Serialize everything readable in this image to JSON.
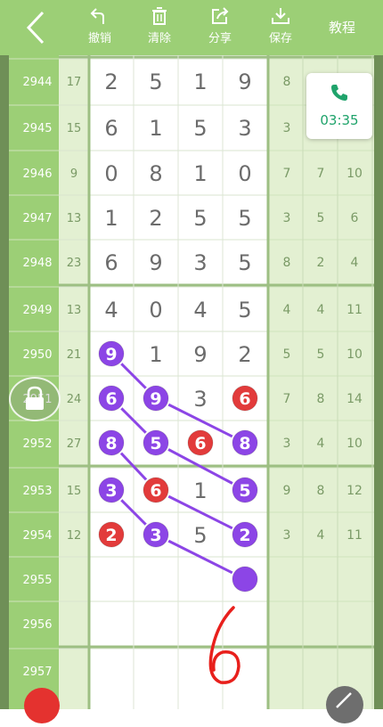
{
  "toolbar": {
    "undo_label": "撤销",
    "clear_label": "清除",
    "share_label": "分享",
    "save_label": "保存",
    "help_label": "教程",
    "icons": [
      "back-chevron-icon",
      "undo-icon",
      "trash-icon",
      "share-icon",
      "download-icon"
    ]
  },
  "call": {
    "time": "03:35"
  },
  "rows": [
    {
      "id": "2944",
      "sum": "17",
      "digits": [
        "2",
        "5",
        "1",
        "9"
      ],
      "stats": [
        "8",
        "",
        ""
      ]
    },
    {
      "id": "2945",
      "sum": "15",
      "digits": [
        "6",
        "1",
        "5",
        "3"
      ],
      "stats": [
        "3",
        "",
        ""
      ]
    },
    {
      "id": "2946",
      "sum": "9",
      "digits": [
        "0",
        "8",
        "1",
        "0"
      ],
      "stats": [
        "7",
        "7",
        "10"
      ]
    },
    {
      "id": "2947",
      "sum": "13",
      "digits": [
        "1",
        "2",
        "5",
        "5"
      ],
      "stats": [
        "3",
        "5",
        "6"
      ]
    },
    {
      "id": "2948",
      "sum": "23",
      "digits": [
        "6",
        "9",
        "3",
        "5"
      ],
      "stats": [
        "8",
        "2",
        "4"
      ]
    },
    {
      "id": "2949",
      "sum": "13",
      "digits": [
        "4",
        "0",
        "4",
        "5"
      ],
      "stats": [
        "4",
        "4",
        "11"
      ]
    },
    {
      "id": "2950",
      "sum": "21",
      "digits": [
        "9",
        "1",
        "9",
        "2"
      ],
      "stats": [
        "5",
        "5",
        "10"
      ]
    },
    {
      "id": "2951",
      "sum": "24",
      "digits": [
        "6",
        "9",
        "3",
        "6"
      ],
      "stats": [
        "7",
        "8",
        "14"
      ]
    },
    {
      "id": "2952",
      "sum": "27",
      "digits": [
        "8",
        "5",
        "6",
        "8"
      ],
      "stats": [
        "3",
        "4",
        "10"
      ]
    },
    {
      "id": "2953",
      "sum": "15",
      "digits": [
        "3",
        "6",
        "1",
        "5"
      ],
      "stats": [
        "9",
        "8",
        "12"
      ]
    },
    {
      "id": "2954",
      "sum": "12",
      "digits": [
        "2",
        "3",
        "5",
        "2"
      ],
      "stats": [
        "3",
        "4",
        "11"
      ]
    },
    {
      "id": "2955",
      "sum": "",
      "digits": [
        "",
        "",
        "",
        ""
      ],
      "stats": [
        "",
        "",
        ""
      ]
    },
    {
      "id": "2956",
      "sum": "",
      "digits": [
        "",
        "",
        "",
        ""
      ],
      "stats": [
        "",
        "",
        ""
      ]
    },
    {
      "id": "2957",
      "sum": "",
      "digits": [
        "",
        "",
        "",
        ""
      ],
      "stats": [
        "",
        "",
        ""
      ]
    }
  ],
  "markers": [
    {
      "row": 6,
      "col": 0,
      "value": "9",
      "color": "purple"
    },
    {
      "row": 7,
      "col": 0,
      "value": "6",
      "color": "purple"
    },
    {
      "row": 7,
      "col": 1,
      "value": "9",
      "color": "purple"
    },
    {
      "row": 7,
      "col": 3,
      "value": "6",
      "color": "red"
    },
    {
      "row": 8,
      "col": 0,
      "value": "8",
      "color": "purple"
    },
    {
      "row": 8,
      "col": 1,
      "value": "5",
      "color": "purple"
    },
    {
      "row": 8,
      "col": 2,
      "value": "6",
      "color": "red"
    },
    {
      "row": 8,
      "col": 3,
      "value": "8",
      "color": "purple"
    },
    {
      "row": 9,
      "col": 0,
      "value": "3",
      "color": "purple"
    },
    {
      "row": 9,
      "col": 1,
      "value": "6",
      "color": "red"
    },
    {
      "row": 9,
      "col": 3,
      "value": "5",
      "color": "purple"
    },
    {
      "row": 10,
      "col": 0,
      "value": "2",
      "color": "red"
    },
    {
      "row": 10,
      "col": 1,
      "value": "3",
      "color": "purple"
    },
    {
      "row": 10,
      "col": 3,
      "value": "2",
      "color": "purple"
    },
    {
      "row": 11,
      "col": 3,
      "value": "",
      "color": "purple"
    }
  ],
  "lines": [
    {
      "from": [
        6,
        0
      ],
      "to": [
        7,
        1
      ]
    },
    {
      "from": [
        7,
        1
      ],
      "to": [
        8,
        3
      ]
    },
    {
      "from": [
        7,
        0
      ],
      "to": [
        8,
        1
      ]
    },
    {
      "from": [
        8,
        1
      ],
      "to": [
        9,
        3
      ]
    },
    {
      "from": [
        8,
        0
      ],
      "to": [
        9,
        1
      ]
    },
    {
      "from": [
        9,
        1
      ],
      "to": [
        10,
        3
      ]
    },
    {
      "from": [
        9,
        0
      ],
      "to": [
        10,
        1
      ]
    },
    {
      "from": [
        10,
        1
      ],
      "to": [
        11,
        3
      ]
    }
  ],
  "annotation": {
    "text": "6",
    "color": "#e8201c"
  },
  "colors": {
    "purple": "#8c45e6",
    "red": "#e23b3b",
    "header_green": "#9ccf76",
    "digit_text": "#6c6c6c",
    "call_green": "#1fa36b"
  }
}
